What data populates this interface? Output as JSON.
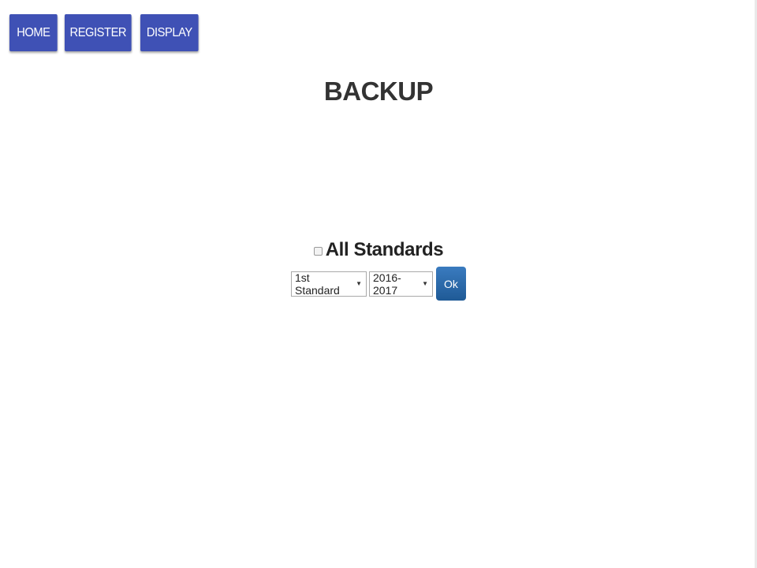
{
  "nav": {
    "home_label": "HOME",
    "register_label": "REGISTER",
    "display_label": "DISPLAY"
  },
  "page": {
    "title": "BACKUP"
  },
  "form": {
    "all_standards_label": "All Standards",
    "all_standards_checked": false,
    "standard_selected": "1st Standard",
    "year_selected": "2016-2017",
    "ok_label": "Ok"
  },
  "colors": {
    "nav_button": "#3f51b5",
    "ok_button": "#2a6aa9",
    "background": "#ffffff"
  },
  "icons": {
    "dropdown": "chevron-down-icon"
  }
}
